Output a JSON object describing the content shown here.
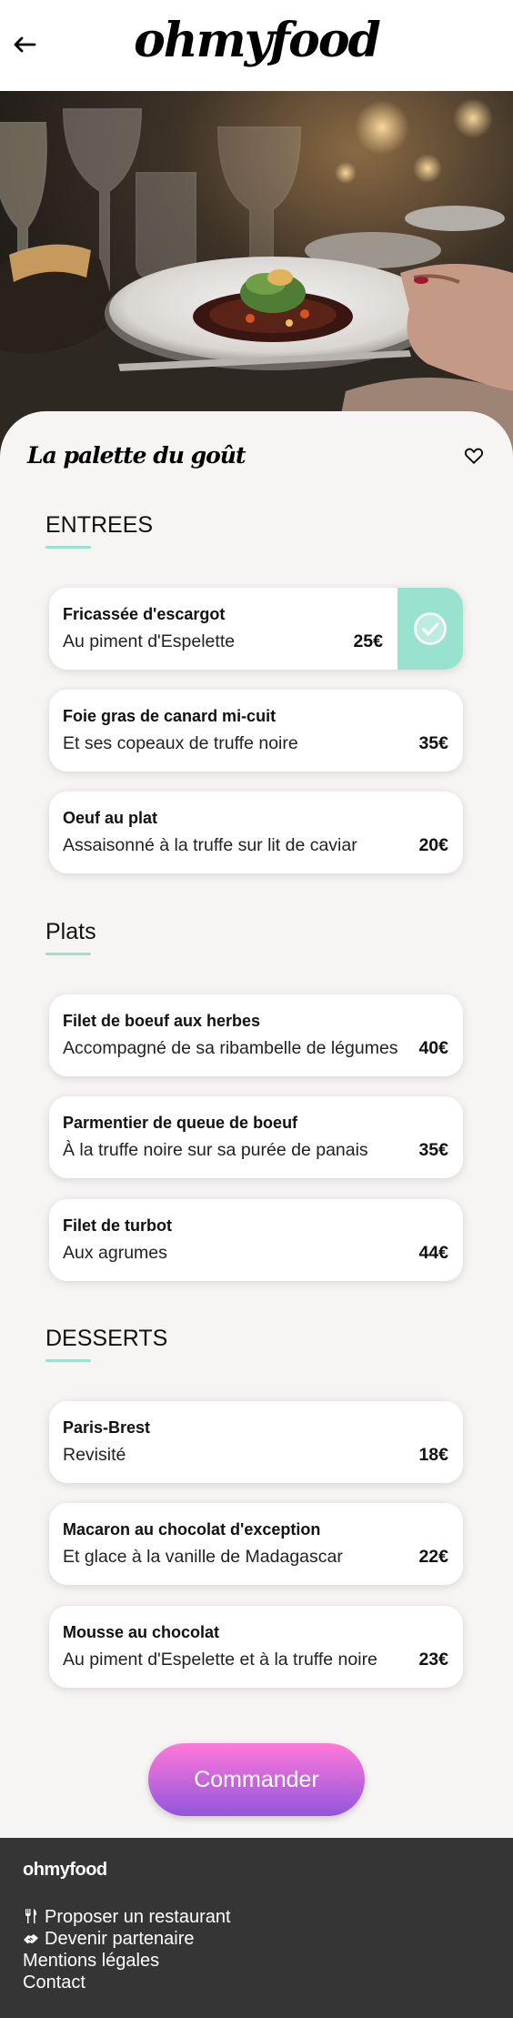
{
  "app": {
    "logo": "ohmyfood",
    "back_icon": "arrow-left-icon"
  },
  "hero": {
    "image": "restaurant-table-dish-photo"
  },
  "restaurant": {
    "name": "La palette du goût",
    "like_icon": "heart-outline-icon"
  },
  "sections": [
    {
      "title": "ENTREES",
      "dishes": [
        {
          "name": "Fricassée d'escargot",
          "description": "Au piment d'Espelette",
          "price": "25€",
          "selected": true
        },
        {
          "name": "Foie gras de canard mi-cuit",
          "description": "Et ses copeaux de truffe noire",
          "price": "35€",
          "selected": false
        },
        {
          "name": "Oeuf au plat",
          "description": "Assaisonné à la truffe sur lit de caviar",
          "price": "20€",
          "selected": false
        }
      ]
    },
    {
      "title": "Plats",
      "dishes": [
        {
          "name": "Filet de boeuf aux herbes",
          "description": "Accompagné de sa ribambelle de légumes",
          "price": "40€",
          "selected": false
        },
        {
          "name": "Parmentier de queue de boeuf",
          "description": "À la truffe noire sur sa purée de panais",
          "price": "35€",
          "selected": false
        },
        {
          "name": "Filet de turbot",
          "description": "Aux agrumes",
          "price": "44€",
          "selected": false
        }
      ]
    },
    {
      "title": "DESSERTS",
      "dishes": [
        {
          "name": "Paris-Brest",
          "description": "Revisité",
          "price": "18€",
          "selected": false
        },
        {
          "name": "Macaron au chocolat d'exception",
          "description": "Et glace à la vanille de Madagascar",
          "price": "22€",
          "selected": false
        },
        {
          "name": "Mousse au chocolat",
          "description": "Au piment d'Espelette et à la truffe noire",
          "price": "23€",
          "selected": false
        }
      ]
    }
  ],
  "order_button": {
    "label": "Commander"
  },
  "footer": {
    "brand": "ohmyfood",
    "links": [
      {
        "label": "Proposer un restaurant",
        "icon": "utensils-icon"
      },
      {
        "label": "Devenir partenaire",
        "icon": "handshake-icon"
      },
      {
        "label": "Mentions légales",
        "icon": ""
      },
      {
        "label": "Contact",
        "icon": ""
      }
    ]
  },
  "colors": {
    "accent": "#99e2d0",
    "gradient_start": "#ff79da",
    "gradient_end": "#9356dc",
    "footer_bg": "#353535",
    "page_bg": "#f7f4f4"
  }
}
